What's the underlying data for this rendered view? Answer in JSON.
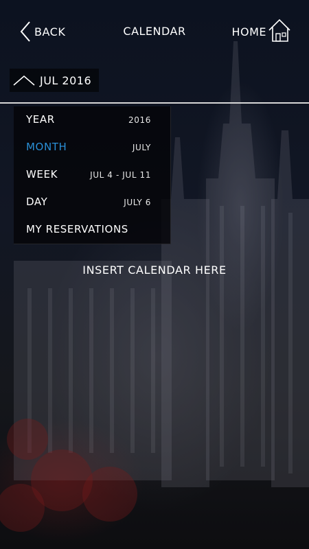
{
  "header": {
    "back_label": "BACK",
    "title": "CALENDAR",
    "home_label": "HOME"
  },
  "icons": {
    "back": "chevron-left-icon",
    "home": "house-icon",
    "toggle": "chevron-up-icon"
  },
  "month_selector": {
    "current": "JUL 2016",
    "expanded": true
  },
  "menu": {
    "items": [
      {
        "label": "YEAR",
        "value": "2016",
        "active": false
      },
      {
        "label": "MONTH",
        "value": "JULY",
        "active": true
      },
      {
        "label": "WEEK",
        "value": "JUL 4 - JUL 11",
        "active": false
      },
      {
        "label": "DAY",
        "value": "JULY 6",
        "active": false
      },
      {
        "label": "MY RESERVATIONS",
        "value": "",
        "active": false
      }
    ]
  },
  "main": {
    "placeholder_text": "INSERT CALENDAR HERE"
  },
  "colors": {
    "accent": "#2a8fd6",
    "text": "#ffffff",
    "divider": "#d8d8d8"
  }
}
